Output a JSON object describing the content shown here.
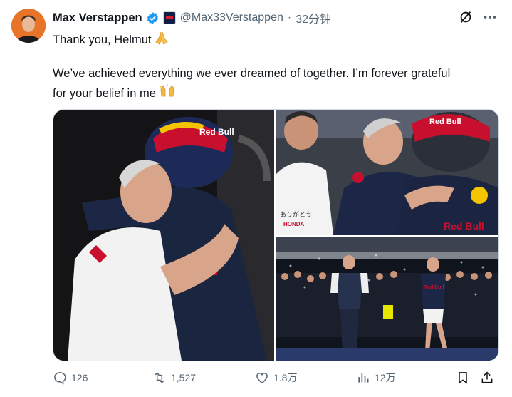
{
  "tweet": {
    "author_name": "Max Verstappen",
    "handle": "@Max33Verstappen",
    "separator": "·",
    "time": "32分钟",
    "line1": "Thank you, Helmut",
    "line2": "We’ve achieved everything we ever dreamed of together. I’m forever grateful",
    "line3": "for your belief in me"
  },
  "media": {
    "photo_left_sign": "Red Bull",
    "photo_top_right_sign": "Red Bull",
    "photo_bottom_right_sign": "Red Bull",
    "photo_top_right_text": "ありがとう",
    "photo_top_right_brand": "HONDA"
  },
  "actions": {
    "reply_count": "126",
    "retweet_count": "1,527",
    "like_count": "1.8万",
    "view_count": "12万"
  },
  "colors": {
    "verified_blue": "#1d9bf0",
    "muted_gray": "#536471",
    "text": "#0f1419"
  },
  "icons": [
    "verified-icon",
    "grok-icon",
    "more-icon",
    "reply-icon",
    "retweet-icon",
    "like-icon",
    "views-icon",
    "bookmark-icon",
    "share-icon"
  ]
}
